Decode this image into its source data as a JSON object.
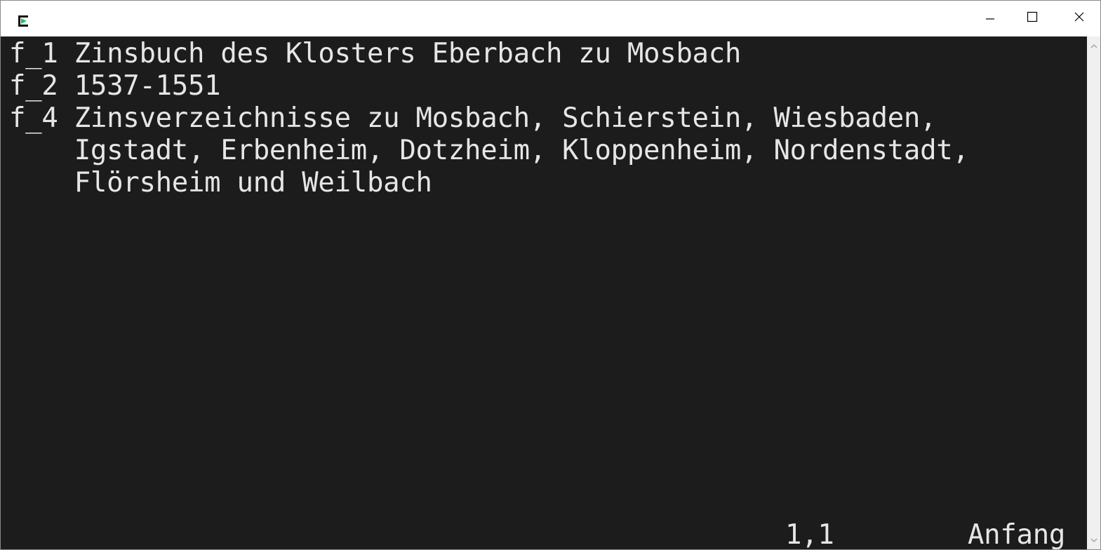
{
  "window": {
    "icon": "console-app-icon",
    "controls": {
      "minimize": "minimize-icon",
      "maximize": "maximize-icon",
      "close": "close-icon"
    }
  },
  "editor": {
    "lines": [
      "f_1 Zinsbuch des Klosters Eberbach zu Mosbach",
      "f_2 1537-1551",
      "f_4 Zinsverzeichnisse zu Mosbach, Schierstein, Wiesbaden,",
      "    Igstadt, Erbenheim, Dotzheim, Kloppenheim, Nordenstadt,",
      "    Flörsheim und Weilbach"
    ],
    "status_position": "1,1",
    "status_where": "Anfang"
  },
  "colors": {
    "terminal_background": "#1c1c1c",
    "terminal_text": "#e6e6e6",
    "titlebar_background": "#ffffff",
    "icon_green": "#22c55e"
  }
}
